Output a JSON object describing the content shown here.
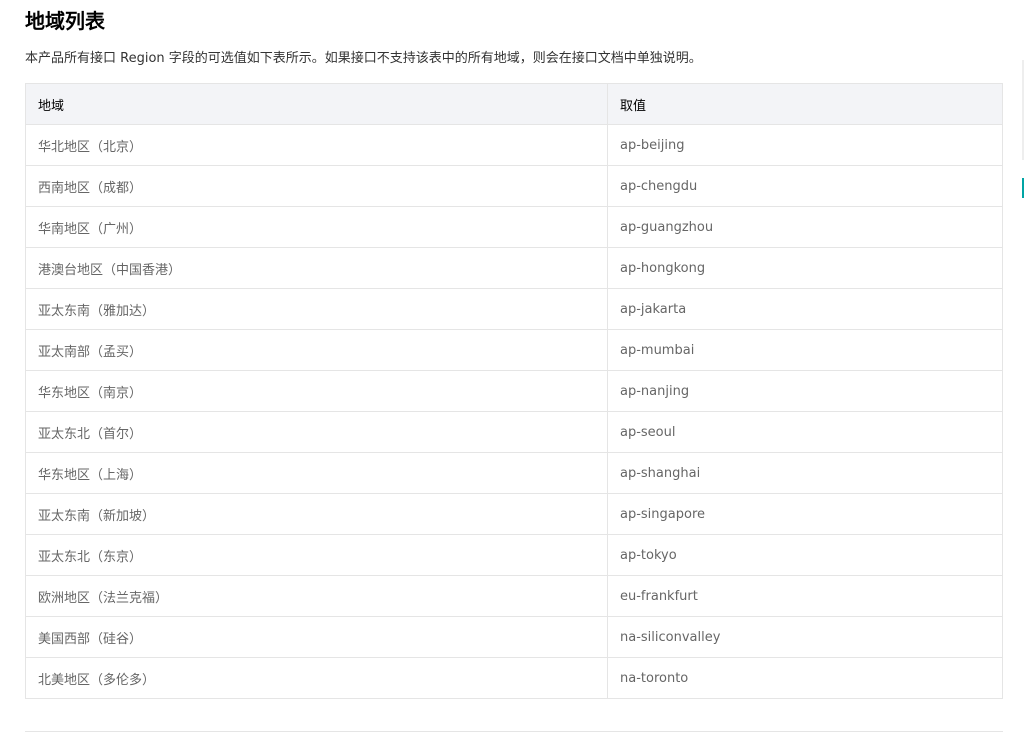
{
  "page": {
    "title": "地域列表",
    "description": "本产品所有接口 Region 字段的可选值如下表所示。如果接口不支持该表中的所有地域，则会在接口文档中单独说明。"
  },
  "table": {
    "headers": {
      "region": "地域",
      "value": "取值"
    },
    "rows": [
      {
        "region": "华北地区（北京）",
        "value": "ap-beijing"
      },
      {
        "region": "西南地区（成都）",
        "value": "ap-chengdu"
      },
      {
        "region": "华南地区（广州）",
        "value": "ap-guangzhou"
      },
      {
        "region": "港澳台地区（中国香港）",
        "value": "ap-hongkong"
      },
      {
        "region": "亚太东南（雅加达）",
        "value": "ap-jakarta"
      },
      {
        "region": "亚太南部（孟买）",
        "value": "ap-mumbai"
      },
      {
        "region": "华东地区（南京）",
        "value": "ap-nanjing"
      },
      {
        "region": "亚太东北（首尔）",
        "value": "ap-seoul"
      },
      {
        "region": "华东地区（上海）",
        "value": "ap-shanghai"
      },
      {
        "region": "亚太东南（新加坡）",
        "value": "ap-singapore"
      },
      {
        "region": "亚太东北（东京）",
        "value": "ap-tokyo"
      },
      {
        "region": "欧洲地区（法兰克福）",
        "value": "eu-frankfurt"
      },
      {
        "region": "美国西部（硅谷）",
        "value": "na-siliconvalley"
      },
      {
        "region": "北美地区（多伦多）",
        "value": "na-toronto"
      }
    ]
  },
  "colors": {
    "header_bg": "#f3f4f7",
    "border": "#e5e5e5",
    "cell_text": "#666666",
    "accent": "#00a4a4"
  }
}
